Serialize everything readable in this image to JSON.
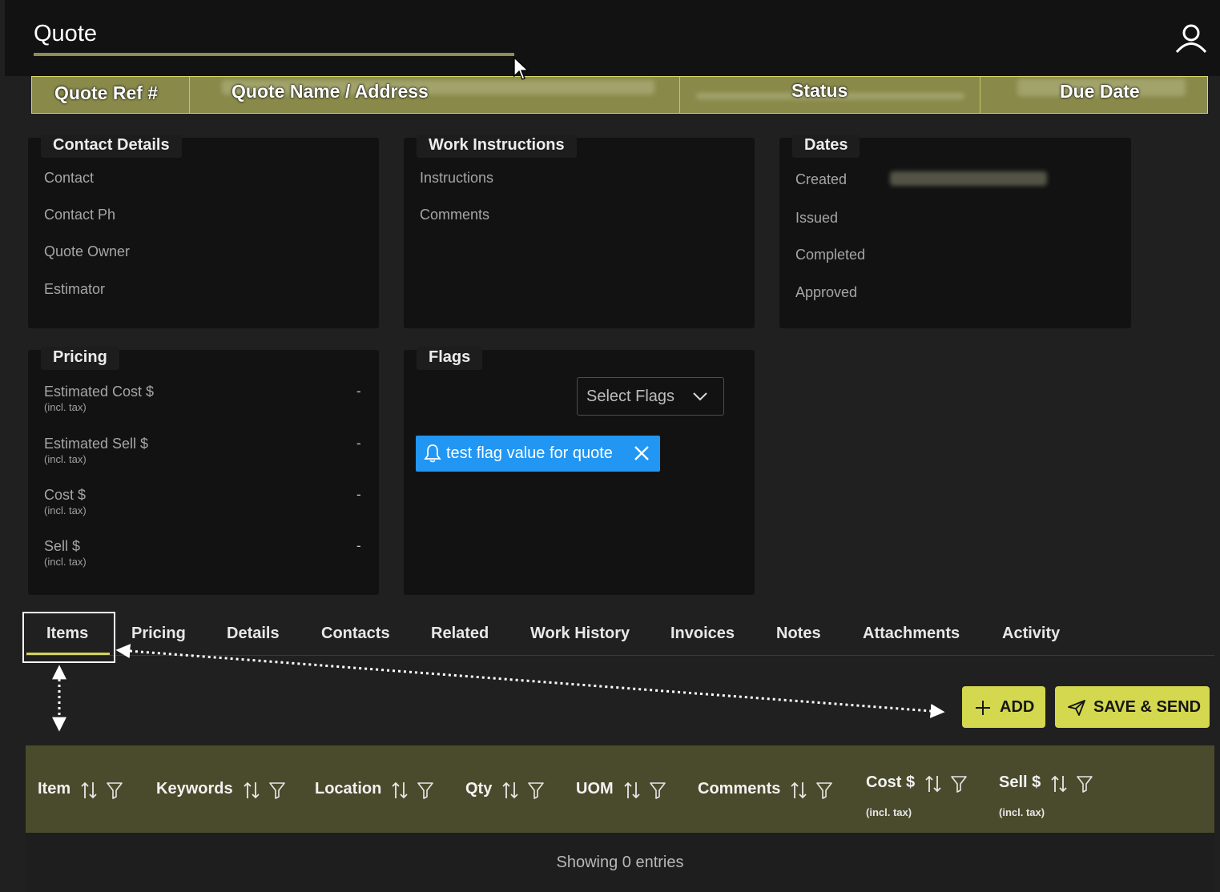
{
  "header": {
    "title": "Quote",
    "user_icon": "user-icon"
  },
  "summary_strip": {
    "quote_ref_label": "Quote Ref #",
    "quote_name_label": "Quote Name / Address",
    "status_label": "Status",
    "due_date_label": "Due Date"
  },
  "contact_details": {
    "title": "Contact Details",
    "fields": [
      "Contact",
      "Contact Ph",
      "Quote Owner",
      "Estimator"
    ]
  },
  "work_instructions": {
    "title": "Work Instructions",
    "fields": [
      "Instructions",
      "Comments"
    ]
  },
  "dates": {
    "title": "Dates",
    "fields": [
      "Created",
      "Issued",
      "Completed",
      "Approved"
    ]
  },
  "pricing": {
    "title": "Pricing",
    "rows": [
      {
        "label": "Estimated Cost $",
        "sub": "(incl. tax)",
        "value": "-"
      },
      {
        "label": "Estimated Sell $",
        "sub": "(incl. tax)",
        "value": "-"
      },
      {
        "label": "Cost $",
        "sub": "(incl. tax)",
        "value": "-"
      },
      {
        "label": "Sell $",
        "sub": "(incl. tax)",
        "value": "-"
      }
    ]
  },
  "flags": {
    "title": "Flags",
    "select_placeholder": "Select Flags",
    "chips": [
      "test flag value for quote"
    ]
  },
  "tabs": [
    "Items",
    "Pricing",
    "Details",
    "Contacts",
    "Related",
    "Work History",
    "Invoices",
    "Notes",
    "Attachments",
    "Activity"
  ],
  "actions": {
    "add_label": "ADD",
    "save_send_label": "SAVE & SEND"
  },
  "table": {
    "columns": [
      {
        "label": "Item"
      },
      {
        "label": "Keywords"
      },
      {
        "label": "Location"
      },
      {
        "label": "Qty"
      },
      {
        "label": "UOM"
      },
      {
        "label": "Comments"
      },
      {
        "label": "Cost $",
        "sub": "(incl. tax)"
      },
      {
        "label": "Sell $",
        "sub": "(incl. tax)"
      }
    ],
    "empty_text": "Showing 0 entries"
  },
  "colors": {
    "accent": "#d4d84e",
    "strip": "#898a4a",
    "header_row": "#4a4b2c",
    "chip": "#2196f3"
  }
}
